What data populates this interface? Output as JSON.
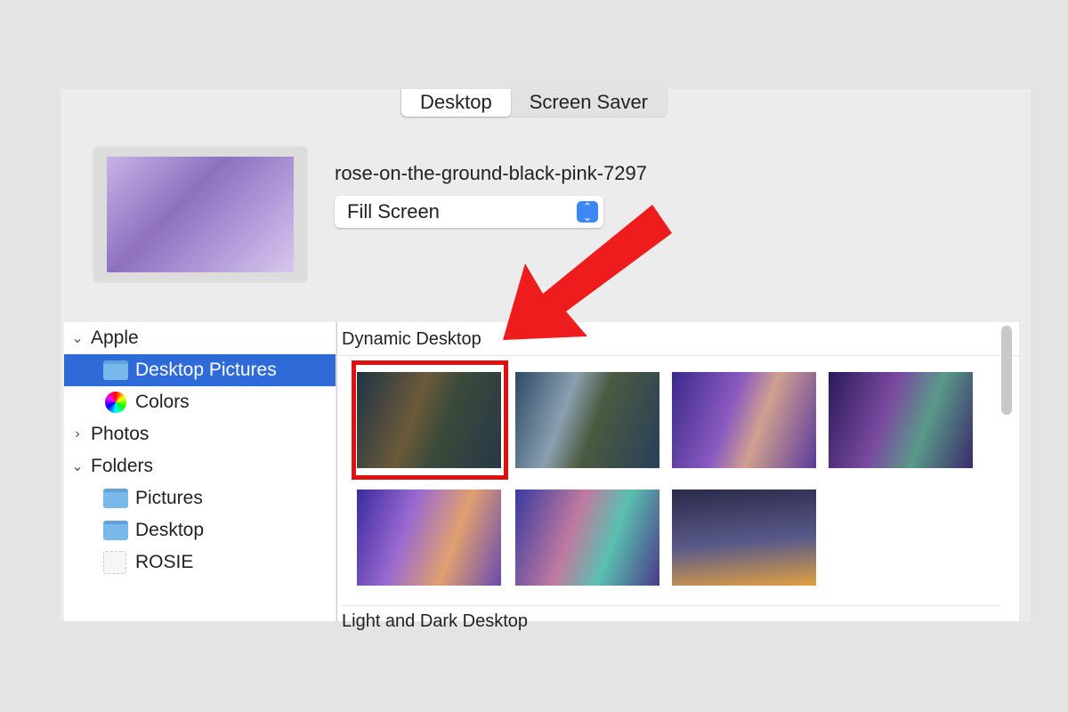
{
  "tabs": [
    {
      "label": "Desktop",
      "active": true
    },
    {
      "label": "Screen Saver",
      "active": false
    }
  ],
  "wallpaper_name": "rose-on-the-ground-black-pink-7297",
  "fit_mode": "Fill Screen",
  "sidebar": {
    "items": [
      {
        "label": "Apple",
        "type": "group",
        "expanded": true
      },
      {
        "label": "Desktop Pictures",
        "icon": "folder-icon",
        "selected": true
      },
      {
        "label": "Colors",
        "icon": "color-wheel-icon"
      },
      {
        "label": "Photos",
        "type": "group",
        "expanded": false
      },
      {
        "label": "Folders",
        "type": "group",
        "expanded": true
      },
      {
        "label": "Pictures",
        "icon": "folder-icon"
      },
      {
        "label": "Desktop",
        "icon": "folder-icon"
      },
      {
        "label": "ROSIE",
        "icon": "volume-icon"
      }
    ]
  },
  "sections": [
    {
      "title": "Dynamic Desktop"
    },
    {
      "title": "Light and Dark Desktop"
    }
  ],
  "highlight_color": "#e01010",
  "accent": "#2f6ad9"
}
